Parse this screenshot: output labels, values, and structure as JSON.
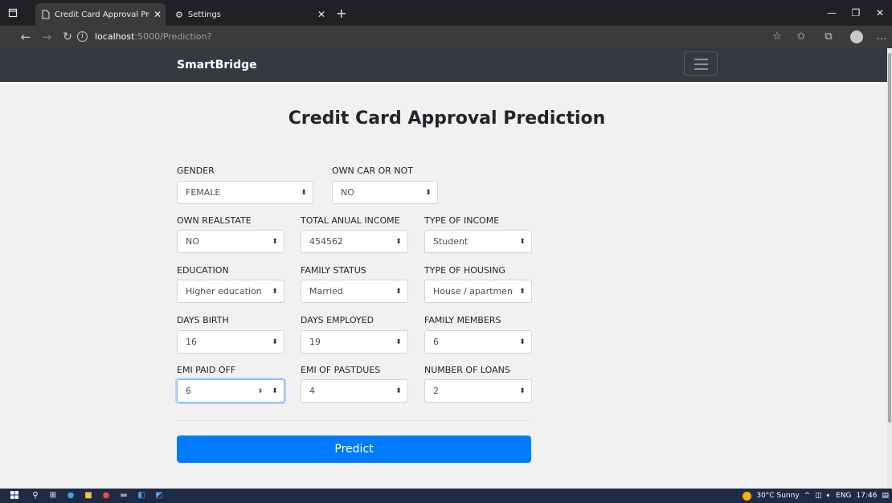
{
  "browser": {
    "tabs": [
      {
        "title": "Credit Card Approval Prediction",
        "active": true
      },
      {
        "title": "Settings",
        "active": false
      }
    ],
    "url_host": "localhost",
    "url_path": ":5000/Prediction?"
  },
  "navbar": {
    "brand": "SmartBridge"
  },
  "page": {
    "title": "Credit Card Approval Prediction"
  },
  "form": {
    "gender": {
      "label": "GENDER",
      "value": "FEMALE"
    },
    "own_car": {
      "label": "OWN CAR OR NOT",
      "value": "NO"
    },
    "own_realstate": {
      "label": "OWN REALSTATE",
      "value": "NO"
    },
    "total_income": {
      "label": "TOTAL ANUAL INCOME",
      "value": "454562"
    },
    "income_type": {
      "label": "TYPE OF INCOME",
      "value": "Student"
    },
    "education": {
      "label": "EDUCATION",
      "value": "Higher education"
    },
    "family_status": {
      "label": "FAMILY STATUS",
      "value": "Married"
    },
    "housing_type": {
      "label": "TYPE OF HOUSING",
      "value": "House / apartment"
    },
    "days_birth": {
      "label": "DAYS BIRTH",
      "value": "16"
    },
    "days_employed": {
      "label": "DAYS EMPLOYED",
      "value": "19"
    },
    "family_members": {
      "label": "FAMILY MEMBERS",
      "value": "6"
    },
    "emi_paid_off": {
      "label": "EMI PAID OFF",
      "value": "6"
    },
    "emi_pastdues": {
      "label": "EMI OF PASTDUES",
      "value": "4"
    },
    "number_of_loans": {
      "label": "NUMBER OF LOANS",
      "value": "2"
    },
    "predict_label": "Predict"
  },
  "taskbar": {
    "weather": "30°C  Sunny",
    "language": "ENG",
    "time": "17:46"
  },
  "colors": {
    "navbar": "#343a40",
    "primary_button": "#007bff",
    "page_background": "#f1f1f1"
  }
}
